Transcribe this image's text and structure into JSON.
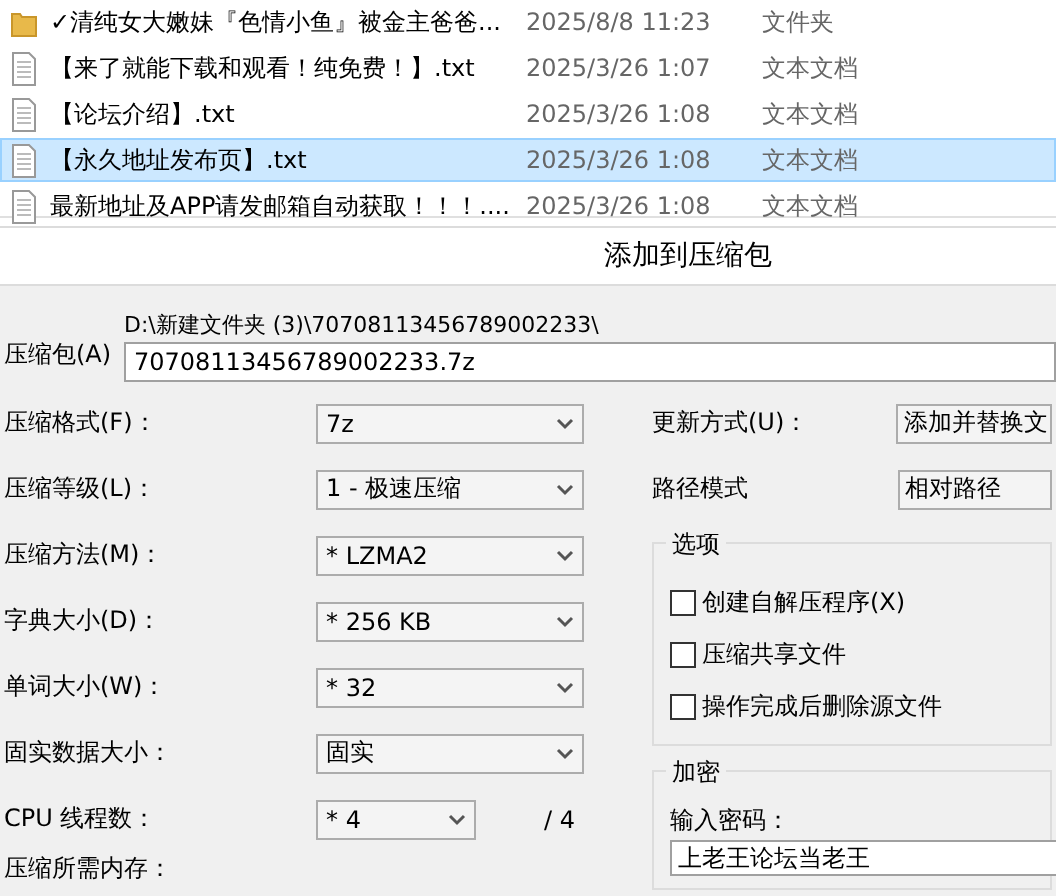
{
  "files": [
    {
      "kind": "folder",
      "name": "✓清纯女大嫩妹『色情小鱼』被金主爸爸...",
      "date": "2025/8/8 11:23",
      "type": "文件夹",
      "selected": false
    },
    {
      "kind": "text",
      "name": "【来了就能下载和观看！纯免费！】.txt",
      "date": "2025/3/26 1:07",
      "type": "文本文档",
      "selected": false
    },
    {
      "kind": "text",
      "name": "【论坛介绍】.txt",
      "date": "2025/3/26 1:08",
      "type": "文本文档",
      "selected": false
    },
    {
      "kind": "text",
      "name": "【永久地址发布页】.txt",
      "date": "2025/3/26 1:08",
      "type": "文本文档",
      "selected": true
    },
    {
      "kind": "text",
      "name": "最新地址及APP请发邮箱自动获取！！！....",
      "date": "2025/3/26 1:08",
      "type": "文本文档",
      "selected": false
    }
  ],
  "dialog": {
    "title": "添加到压缩包",
    "archive": {
      "label": "压缩包(A)",
      "path": "D:\\新建文件夹 (3)\\70708113456789002233\\",
      "value": "70708113456789002233.7z"
    },
    "settings": [
      {
        "label": "压缩格式(F)：",
        "value": "7z"
      },
      {
        "label": "压缩等级(L)：",
        "value": "1 - 极速压缩"
      },
      {
        "label": "压缩方法(M)：",
        "value": "* LZMA2"
      },
      {
        "label": "字典大小(D)：",
        "value": "* 256 KB"
      },
      {
        "label": "单词大小(W)：",
        "value": "* 32"
      },
      {
        "label": "固实数据大小：",
        "value": "固实"
      }
    ],
    "cpu": {
      "label": "CPU 线程数：",
      "value": "* 4",
      "total": "/ 4"
    },
    "memory_label": "压缩所需内存：",
    "update_mode": {
      "label": "更新方式(U)：",
      "value": "添加并替换文"
    },
    "path_mode": {
      "label": "路径模式",
      "value": "相对路径"
    },
    "options": {
      "title": "选项",
      "items": [
        {
          "label": "创建自解压程序(X)",
          "checked": false
        },
        {
          "label": "压缩共享文件",
          "checked": false
        },
        {
          "label": "操作完成后删除源文件",
          "checked": false
        }
      ]
    },
    "encryption": {
      "title": "加密",
      "label": "输入密码：",
      "value": "上老王论坛当老王"
    }
  }
}
